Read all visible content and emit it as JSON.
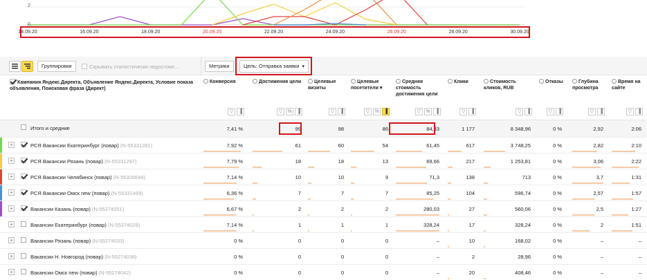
{
  "chart": {
    "y_tick_labels": [
      "2",
      "0"
    ],
    "dates": [
      "14.09.20",
      "16.09.20",
      "18.09.20",
      "20.09.20",
      "22.09.20",
      "24.09.20",
      "26.09.20",
      "28.09.20",
      "30.09.20"
    ],
    "weekend_dates": [
      "20.09.20",
      "26.09.20"
    ],
    "colors": {
      "purple": "#9c4fc3",
      "green": "#7ad64a",
      "yellow": "#f2cf3c",
      "red": "#e0433a",
      "orange": "#ef8e3b",
      "blue": "#4a90d9"
    }
  },
  "toolbar": {
    "groupings_label": "Группировки",
    "hide_stats_label": "Скрывать статистически недостове…",
    "metrics_label": "Метрики",
    "goal_label": "Цель: Отправка заявки"
  },
  "header": {
    "main_column": "Кампания Яндекс.Директа, Объявление Яндекс.Директа, Условие показа объявления, Поисковая фраза (Директ)",
    "columns": [
      {
        "label": "Конверсия"
      },
      {
        "label": "Достижения цели"
      },
      {
        "label": "Целевые визиты"
      },
      {
        "label": "Целевые посетители ▾"
      },
      {
        "label": "Средняя стоимость достижения цели"
      },
      {
        "label": "Клики"
      },
      {
        "label": "Стоимость кликов, RUB"
      },
      {
        "label": "Отказы"
      },
      {
        "label": "Глубина просмотра"
      },
      {
        "label": "Время на сайте"
      }
    ]
  },
  "totals": {
    "label": "Итого и средние",
    "values": [
      "7,41 %",
      "99",
      "98",
      "86",
      "84,33",
      "1 177",
      "8 348,96",
      "0 %",
      "2,92",
      "2:06"
    ]
  },
  "rows": [
    {
      "name": "РСЯ Вакансии Екатеринбург (повар)",
      "id": "(N-55331281)",
      "checked": true,
      "strip": "#7ad64a",
      "values": [
        "7,92 %",
        "61",
        "60",
        "54",
        "61,45",
        "617",
        "3 748,25",
        "0 %",
        "2,82",
        "2:10"
      ],
      "bars": [
        0.95,
        0.62,
        0.62,
        0.63,
        0.6,
        0.52,
        0.45,
        0,
        0.8,
        0.8
      ]
    },
    {
      "name": "РСЯ Вакансии Рязань (повар)",
      "id": "(N-55331297)",
      "checked": true,
      "strip": "#f2cf3c",
      "values": [
        "7,79 %",
        "18",
        "18",
        "13",
        "69,66",
        "217",
        "1 253,81",
        "0 %",
        "3,06",
        "2:22"
      ],
      "bars": [
        0.9,
        0.18,
        0.18,
        0.15,
        0.7,
        0.18,
        0.15,
        0,
        0.9,
        0.9
      ]
    },
    {
      "name": "РСЯ Вакансии Челябинск (повар)",
      "id": "(N-55326694)",
      "checked": true,
      "strip": "#e0433a",
      "values": [
        "7,14 %",
        "10",
        "10",
        "9",
        "71,3",
        "138",
        "713",
        "0 %",
        "3,7",
        "1:31"
      ],
      "bars": [
        0.85,
        0.1,
        0.1,
        0.1,
        0.72,
        0.12,
        0.09,
        0,
        1,
        0.6
      ]
    },
    {
      "name": "РСЯ Вакансии Омск new (повар)",
      "id": "(N-55331469)",
      "checked": true,
      "strip": "#4a90d9",
      "values": [
        "6,36 %",
        "7",
        "7",
        "7",
        "85,25",
        "104",
        "596,74",
        "0 %",
        "2,57",
        "1:57"
      ],
      "bars": [
        0.78,
        0.07,
        0.07,
        0.08,
        0.86,
        0.09,
        0.07,
        0,
        0.72,
        0.72
      ]
    },
    {
      "name": "Вакансии Казань (повар)",
      "id": "(N-55274051)",
      "checked": true,
      "strip": "#9c4fc3",
      "values": [
        "6,67 %",
        "2",
        "2",
        "2",
        "280,03",
        "27",
        "560,06",
        "0 %",
        "2,5",
        "1:27"
      ],
      "bars": [
        0.82,
        0.02,
        0.02,
        0.02,
        1,
        0.03,
        0.07,
        0,
        0.7,
        0.55
      ]
    },
    {
      "name": "Вакансии Екатеринбург (повар)",
      "id": "(N-55274028)",
      "checked": false,
      "strip": "",
      "values": [
        "7,14 %",
        "1",
        "1",
        "1",
        "328,24",
        "17",
        "328,24",
        "0 %",
        "2",
        "1:51"
      ],
      "bars": [
        0.85,
        0.01,
        0.01,
        0.01,
        1,
        0.02,
        0.04,
        0,
        0.55,
        0.7
      ]
    },
    {
      "name": "Вакансии Рязань (повар)",
      "id": "(N-55274033)",
      "checked": false,
      "strip": "",
      "values": [
        "0 %",
        "0",
        "0",
        "0",
        "–",
        "10",
        "168,02",
        "0 %",
        "–",
        "–"
      ],
      "bars": [
        0,
        0,
        0,
        0,
        0,
        0.01,
        0.02,
        0,
        0,
        0
      ]
    },
    {
      "name": "Вакансии Н. Новгород (повар)",
      "id": "(N-55274038)",
      "checked": false,
      "strip": "",
      "values": [
        "0 %",
        "0",
        "0",
        "0",
        "–",
        "2",
        "28,96",
        "0 %",
        "–",
        "–"
      ],
      "bars": [
        0,
        0,
        0,
        0,
        0,
        0,
        0,
        0,
        0,
        0
      ]
    },
    {
      "name": "Вакансии Омск new (повар)",
      "id": "(N-55274042)",
      "checked": false,
      "strip": "",
      "values": [
        "0 %",
        "0",
        "0",
        "0",
        "–",
        "20",
        "408,46",
        "0 %",
        "–",
        "–"
      ],
      "bars": [
        0,
        0,
        0,
        0,
        0,
        0.02,
        0.05,
        0,
        0,
        0
      ]
    }
  ]
}
